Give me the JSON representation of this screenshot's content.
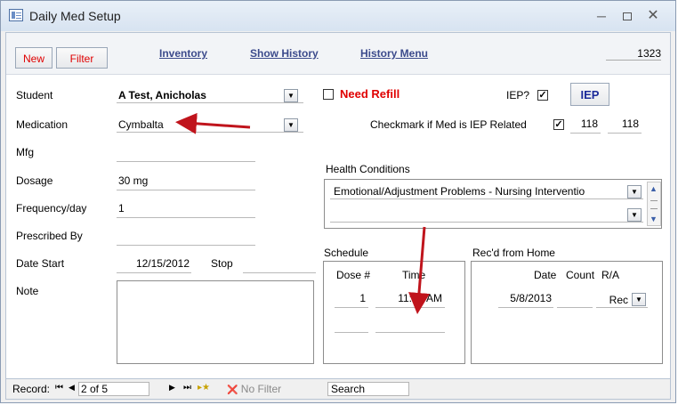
{
  "window": {
    "title": "Daily Med Setup"
  },
  "toolbar": {
    "new_label": "New",
    "filter_label": "Filter",
    "record_number": "1323"
  },
  "links": {
    "inventory": "Inventory",
    "show_history": "Show History",
    "history_menu": "History Menu"
  },
  "form": {
    "student_label": "Student",
    "student_value": "A Test, Anicholas",
    "medication_label": "Medication",
    "medication_value": "Cymbalta",
    "mfg_label": "Mfg",
    "mfg_value": "",
    "dosage_label": "Dosage",
    "dosage_value": "30 mg",
    "frequency_label": "Frequency/day",
    "frequency_value": "1",
    "prescribed_label": "Prescribed By",
    "prescribed_value": "",
    "date_start_label": "Date Start",
    "date_start_value": "12/15/2012",
    "stop_label": "Stop",
    "stop_value": "",
    "note_label": "Note",
    "note_value": ""
  },
  "right": {
    "need_refill_label": "Need Refill",
    "iep_question": "IEP?",
    "iep_button": "IEP",
    "iep_related_label": "Checkmark if Med is IEP Related",
    "iep_val1": "118",
    "iep_val2": "118",
    "health_conditions_label": "Health Conditions",
    "health_condition_1": "Emotional/Adjustment Problems - Nursing Interventio",
    "health_condition_2": ""
  },
  "schedule": {
    "label": "Schedule",
    "dose_header": "Dose #",
    "time_header": "Time",
    "rows": [
      {
        "dose": "1",
        "time": "11:00 AM"
      }
    ]
  },
  "home": {
    "label": "Rec'd from Home",
    "date_header": "Date",
    "count_header": "Count",
    "ra_header": "R/A",
    "rows": [
      {
        "date": "5/8/2013",
        "count": "",
        "ra": "Rec"
      }
    ]
  },
  "nav": {
    "record_label": "Record:",
    "position": "2 of 5",
    "no_filter": "No Filter",
    "search": "Search"
  },
  "colors": {
    "accent_red": "#e00000",
    "link_blue": "#3c4b8c",
    "arrow": "#c0141c"
  }
}
